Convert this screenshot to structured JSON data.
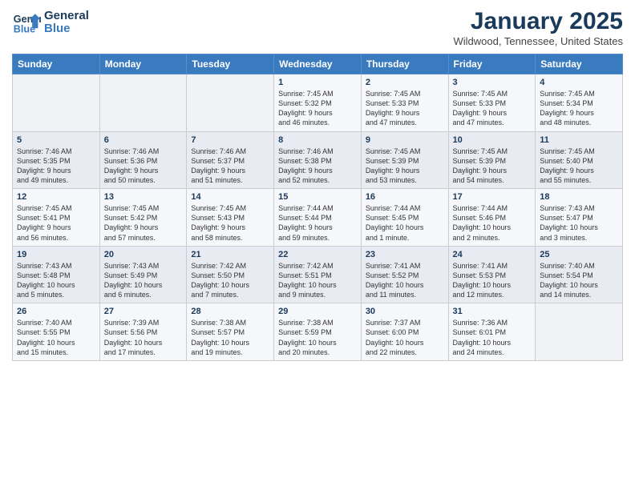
{
  "header": {
    "logo_line1": "General",
    "logo_line2": "Blue",
    "month": "January 2025",
    "location": "Wildwood, Tennessee, United States"
  },
  "days_of_week": [
    "Sunday",
    "Monday",
    "Tuesday",
    "Wednesday",
    "Thursday",
    "Friday",
    "Saturday"
  ],
  "weeks": [
    [
      {
        "day": "",
        "info": ""
      },
      {
        "day": "",
        "info": ""
      },
      {
        "day": "",
        "info": ""
      },
      {
        "day": "1",
        "info": "Sunrise: 7:45 AM\nSunset: 5:32 PM\nDaylight: 9 hours\nand 46 minutes."
      },
      {
        "day": "2",
        "info": "Sunrise: 7:45 AM\nSunset: 5:33 PM\nDaylight: 9 hours\nand 47 minutes."
      },
      {
        "day": "3",
        "info": "Sunrise: 7:45 AM\nSunset: 5:33 PM\nDaylight: 9 hours\nand 47 minutes."
      },
      {
        "day": "4",
        "info": "Sunrise: 7:45 AM\nSunset: 5:34 PM\nDaylight: 9 hours\nand 48 minutes."
      }
    ],
    [
      {
        "day": "5",
        "info": "Sunrise: 7:46 AM\nSunset: 5:35 PM\nDaylight: 9 hours\nand 49 minutes."
      },
      {
        "day": "6",
        "info": "Sunrise: 7:46 AM\nSunset: 5:36 PM\nDaylight: 9 hours\nand 50 minutes."
      },
      {
        "day": "7",
        "info": "Sunrise: 7:46 AM\nSunset: 5:37 PM\nDaylight: 9 hours\nand 51 minutes."
      },
      {
        "day": "8",
        "info": "Sunrise: 7:46 AM\nSunset: 5:38 PM\nDaylight: 9 hours\nand 52 minutes."
      },
      {
        "day": "9",
        "info": "Sunrise: 7:45 AM\nSunset: 5:39 PM\nDaylight: 9 hours\nand 53 minutes."
      },
      {
        "day": "10",
        "info": "Sunrise: 7:45 AM\nSunset: 5:39 PM\nDaylight: 9 hours\nand 54 minutes."
      },
      {
        "day": "11",
        "info": "Sunrise: 7:45 AM\nSunset: 5:40 PM\nDaylight: 9 hours\nand 55 minutes."
      }
    ],
    [
      {
        "day": "12",
        "info": "Sunrise: 7:45 AM\nSunset: 5:41 PM\nDaylight: 9 hours\nand 56 minutes."
      },
      {
        "day": "13",
        "info": "Sunrise: 7:45 AM\nSunset: 5:42 PM\nDaylight: 9 hours\nand 57 minutes."
      },
      {
        "day": "14",
        "info": "Sunrise: 7:45 AM\nSunset: 5:43 PM\nDaylight: 9 hours\nand 58 minutes."
      },
      {
        "day": "15",
        "info": "Sunrise: 7:44 AM\nSunset: 5:44 PM\nDaylight: 9 hours\nand 59 minutes."
      },
      {
        "day": "16",
        "info": "Sunrise: 7:44 AM\nSunset: 5:45 PM\nDaylight: 10 hours\nand 1 minute."
      },
      {
        "day": "17",
        "info": "Sunrise: 7:44 AM\nSunset: 5:46 PM\nDaylight: 10 hours\nand 2 minutes."
      },
      {
        "day": "18",
        "info": "Sunrise: 7:43 AM\nSunset: 5:47 PM\nDaylight: 10 hours\nand 3 minutes."
      }
    ],
    [
      {
        "day": "19",
        "info": "Sunrise: 7:43 AM\nSunset: 5:48 PM\nDaylight: 10 hours\nand 5 minutes."
      },
      {
        "day": "20",
        "info": "Sunrise: 7:43 AM\nSunset: 5:49 PM\nDaylight: 10 hours\nand 6 minutes."
      },
      {
        "day": "21",
        "info": "Sunrise: 7:42 AM\nSunset: 5:50 PM\nDaylight: 10 hours\nand 7 minutes."
      },
      {
        "day": "22",
        "info": "Sunrise: 7:42 AM\nSunset: 5:51 PM\nDaylight: 10 hours\nand 9 minutes."
      },
      {
        "day": "23",
        "info": "Sunrise: 7:41 AM\nSunset: 5:52 PM\nDaylight: 10 hours\nand 11 minutes."
      },
      {
        "day": "24",
        "info": "Sunrise: 7:41 AM\nSunset: 5:53 PM\nDaylight: 10 hours\nand 12 minutes."
      },
      {
        "day": "25",
        "info": "Sunrise: 7:40 AM\nSunset: 5:54 PM\nDaylight: 10 hours\nand 14 minutes."
      }
    ],
    [
      {
        "day": "26",
        "info": "Sunrise: 7:40 AM\nSunset: 5:55 PM\nDaylight: 10 hours\nand 15 minutes."
      },
      {
        "day": "27",
        "info": "Sunrise: 7:39 AM\nSunset: 5:56 PM\nDaylight: 10 hours\nand 17 minutes."
      },
      {
        "day": "28",
        "info": "Sunrise: 7:38 AM\nSunset: 5:57 PM\nDaylight: 10 hours\nand 19 minutes."
      },
      {
        "day": "29",
        "info": "Sunrise: 7:38 AM\nSunset: 5:59 PM\nDaylight: 10 hours\nand 20 minutes."
      },
      {
        "day": "30",
        "info": "Sunrise: 7:37 AM\nSunset: 6:00 PM\nDaylight: 10 hours\nand 22 minutes."
      },
      {
        "day": "31",
        "info": "Sunrise: 7:36 AM\nSunset: 6:01 PM\nDaylight: 10 hours\nand 24 minutes."
      },
      {
        "day": "",
        "info": ""
      }
    ]
  ]
}
